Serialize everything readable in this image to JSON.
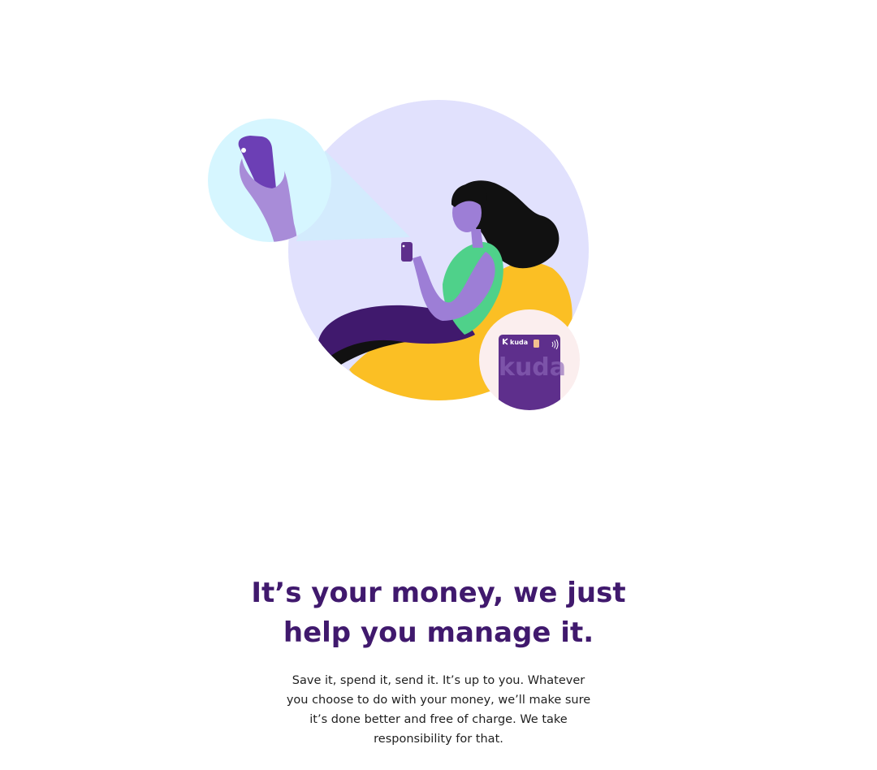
{
  "hero": {
    "headline": "It’s your money, we just help you manage it.",
    "description": "Save it, spend it, send it. It’s up to you. Whatever you choose to do with your money, we’ll make sure it’s done better and free of charge. We take responsibility for that."
  },
  "illustration": {
    "card_brand": "kuda",
    "card_watermark": "kuda",
    "icons": [
      "phone-in-hand-icon",
      "woman-with-phone-illustration",
      "kuda-card-icon",
      "contactless-icon",
      "chip-icon"
    ]
  },
  "colors": {
    "brand_purple": "#40196d",
    "card_purple": "#5e2f8c",
    "accent_yellow": "#fbbf24",
    "accent_green": "#4fd18a",
    "big_circle_lavender": "#e1e1fd",
    "small_circle_cyan": "#d6f6ff",
    "card_circle_pink": "#fbeeee",
    "skin_purple": "#9d7ed6"
  }
}
